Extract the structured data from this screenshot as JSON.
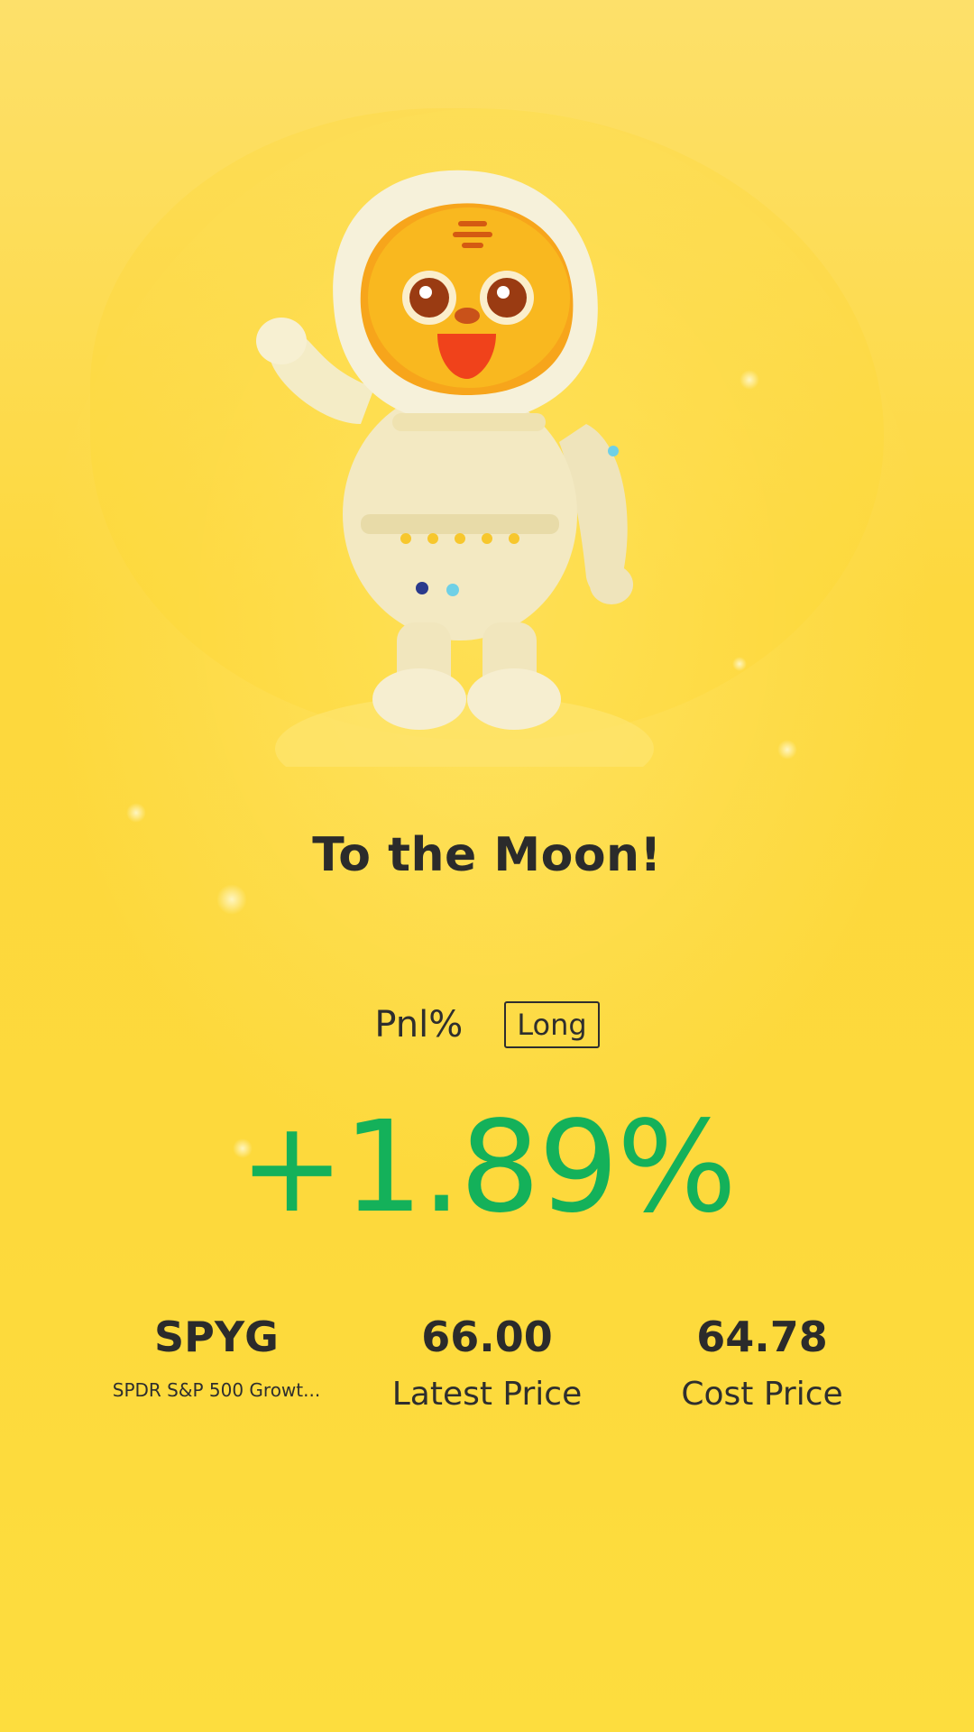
{
  "header": {
    "title": "To the Moon!"
  },
  "pnl": {
    "label": "Pnl%",
    "direction": "Long",
    "value": "+1.89%"
  },
  "stats": {
    "ticker": "SPYG",
    "fund_name": "SPDR S&P 500 Growt...",
    "latest_price": "66.00",
    "latest_price_label": "Latest Price",
    "cost_price": "64.78",
    "cost_price_label": "Cost Price"
  },
  "illustration": {
    "icon": "astronaut-tiger-mascot-icon"
  },
  "colors": {
    "background": "#fdd93c",
    "gain": "#14b15a",
    "text": "#2b2b2b"
  }
}
